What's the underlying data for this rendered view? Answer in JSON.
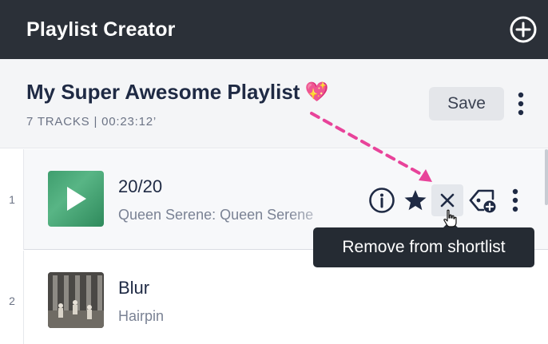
{
  "app": {
    "title": "Playlist Creator",
    "add_icon": "plus-circle-icon"
  },
  "playlist": {
    "title": "My Super Awesome Playlist",
    "emoji": "💖",
    "meta": "7 TRACKS | 00:23:12’",
    "save_label": "Save",
    "more_icon": "vertical-dots-icon"
  },
  "tracks": [
    {
      "index": "1",
      "title": "20/20",
      "artist": "Queen Serene: Queen Serene"
    },
    {
      "index": "2",
      "title": "Blur",
      "artist": "Hairpin"
    }
  ],
  "row_actions": [
    "info-icon",
    "star-icon",
    "close-icon",
    "tag-add-icon",
    "vertical-dots-icon"
  ],
  "tooltip": {
    "text": "Remove from shortlist"
  },
  "colors": {
    "header_bg": "#2b3038",
    "annotation_arrow": "#e8439a",
    "tooltip_bg": "#252b33"
  }
}
